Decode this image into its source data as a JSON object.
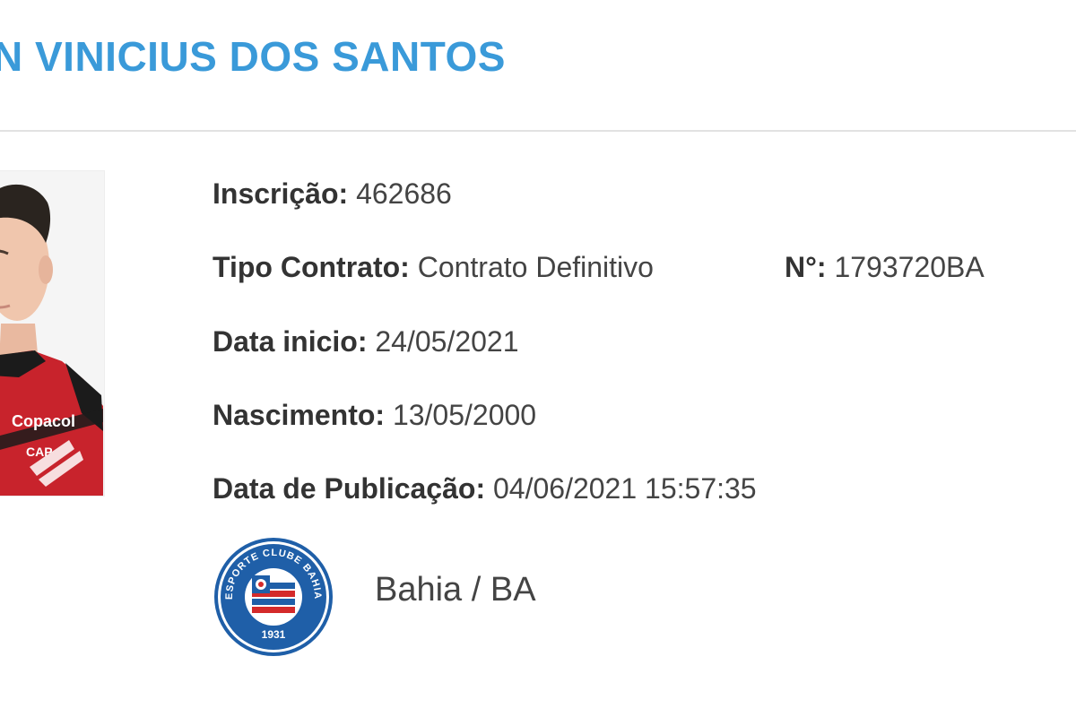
{
  "player": {
    "name": "N VINICIUS DOS SANTOS",
    "photo": {
      "shirt_sponsor": "Copacol",
      "shirt_logo": "CAP"
    }
  },
  "details": {
    "inscricao_label": "Inscrição:",
    "inscricao_value": "462686",
    "tipo_contrato_label": "Tipo Contrato:",
    "tipo_contrato_value": "Contrato Definitivo",
    "numero_label": "N°:",
    "numero_value": "1793720BA",
    "data_inicio_label": "Data inicio:",
    "data_inicio_value": "24/05/2021",
    "nascimento_label": "Nascimento:",
    "nascimento_value": "13/05/2000",
    "publicacao_label": "Data de Publicação:",
    "publicacao_value": "04/06/2021 15:57:35"
  },
  "club": {
    "name": "Bahia / BA",
    "badge_text": "ESPORTE CLUBE BAHIA",
    "badge_year": "1931"
  },
  "colors": {
    "title": "#3a9ad9",
    "badge_blue": "#1f5fa8",
    "badge_red": "#d42a2a",
    "shirt_red": "#c8232c",
    "shirt_black": "#1b1b1b"
  }
}
